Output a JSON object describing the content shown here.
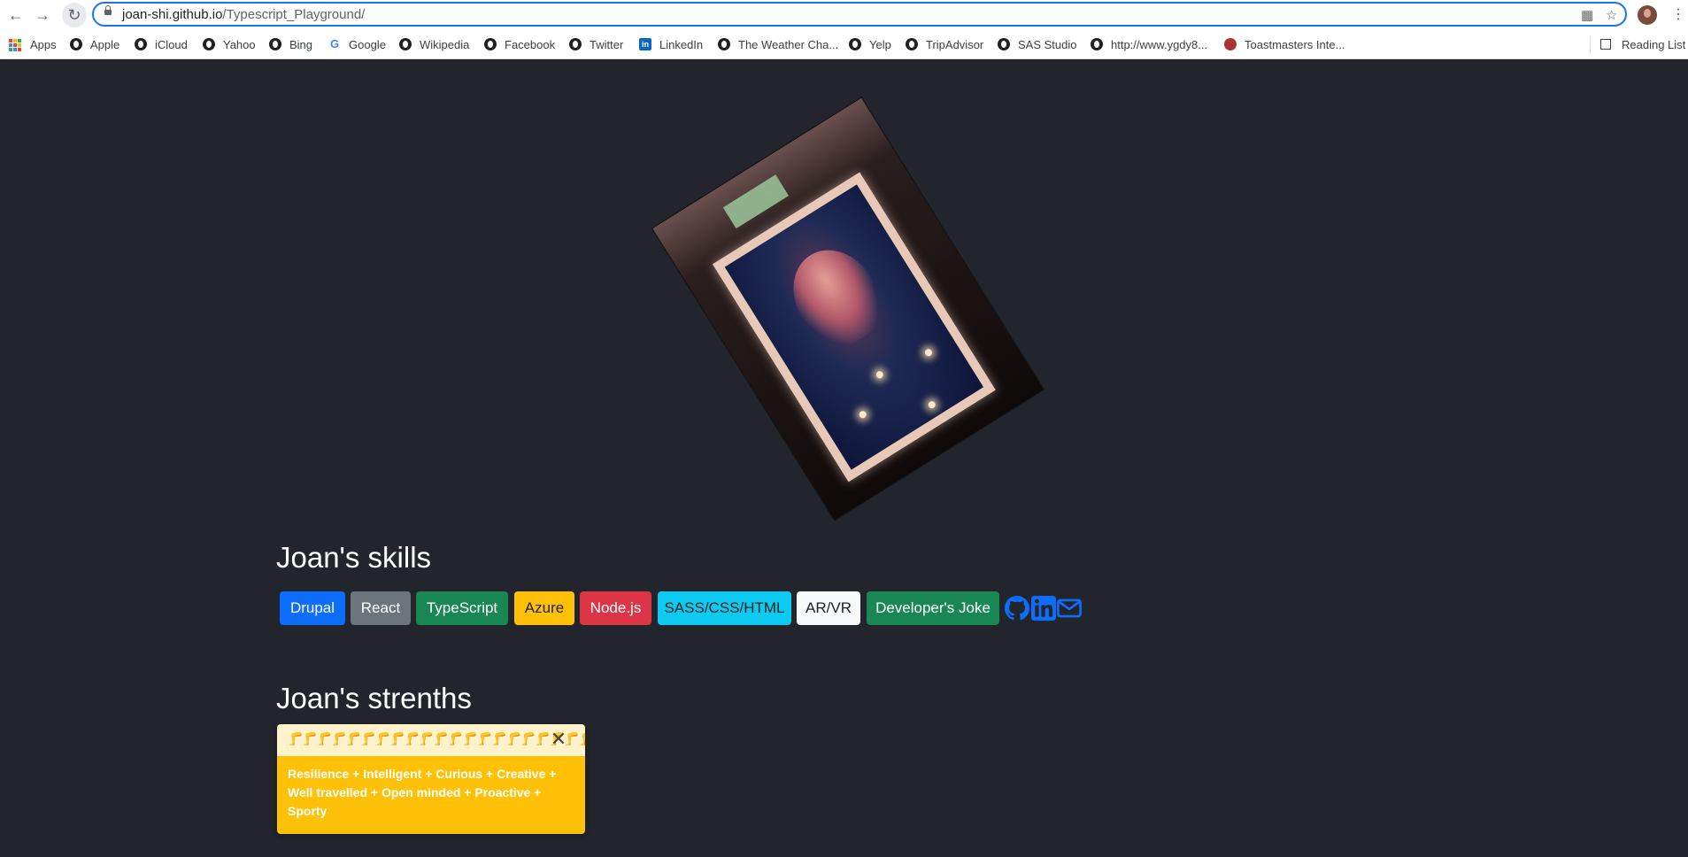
{
  "browser": {
    "url_host": "joan-shi.github.io",
    "url_path": "/Typescript_Playground/",
    "bookmarks": [
      "Apps",
      "Apple",
      "iCloud",
      "Yahoo",
      "Bing",
      "Google",
      "Wikipedia",
      "Facebook",
      "Twitter",
      "LinkedIn",
      "The Weather Cha...",
      "Yelp",
      "TripAdvisor",
      "SAS Studio",
      "http://www.ygdy8...",
      "Toastmasters Inte..."
    ],
    "reading_list": "Reading List"
  },
  "skills": {
    "heading": "Joan's skills",
    "buttons": [
      {
        "label": "Drupal",
        "color": "#0d6efd"
      },
      {
        "label": "React",
        "color": "#6c757d"
      },
      {
        "label": "TypeScript",
        "color": "#198754"
      },
      {
        "label": "Azure",
        "color": "#ffc107"
      },
      {
        "label": "Node.js",
        "color": "#dc3545"
      },
      {
        "label": "SASS/CSS/HTML",
        "color": "#0dcaf0"
      },
      {
        "label": "AR/VR",
        "color": "#f8f9fa"
      },
      {
        "label": "Developer's Joke",
        "color": "#198754"
      }
    ],
    "social_icons": [
      "github-icon",
      "linkedin-icon",
      "mail-icon"
    ]
  },
  "strengths": {
    "heading": "Joan's strenths",
    "toast_icons": "🦵🦵🦵🦵🦵🦵🦵🦵🦵🦵🦵🦵🦵🦵🦵🦵🦵🦵🦵🦵🦵",
    "text": "Resilience + Intelligent + Curious + Creative + Well travelled + Open minded + Proactive + Sporty"
  }
}
